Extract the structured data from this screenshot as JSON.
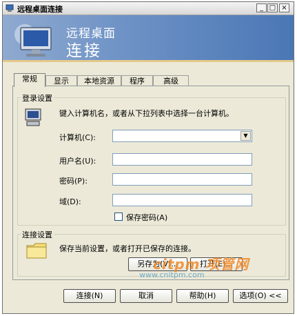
{
  "window": {
    "title": "远程桌面连接",
    "banner_line1": "远程桌面",
    "banner_line2": "连接",
    "controls": {
      "minimize": "_",
      "maximize": "□",
      "close": "×"
    }
  },
  "tabs": [
    {
      "label": "常规"
    },
    {
      "label": "显示"
    },
    {
      "label": "本地资源"
    },
    {
      "label": "程序"
    },
    {
      "label": "高级"
    }
  ],
  "login": {
    "group_label": "登录设置",
    "description": "键入计算机名，或者从下拉列表中选择一台计算机。",
    "computer_label": "计算机(C):",
    "computer_value": "",
    "username_label": "用户名(U):",
    "username_value": "",
    "password_label": "密码(P):",
    "password_value": "",
    "domain_label": "域(D):",
    "domain_value": "",
    "save_password_label": "保存密码(A)",
    "save_password_checked": false
  },
  "connection": {
    "group_label": "连接设置",
    "description": "保存当前设置，或者打开已保存的连接。",
    "save_as_label": "另存为(V)...",
    "open_label": "打开(E)..."
  },
  "footer": {
    "connect_label": "连接(N)",
    "cancel_label": "取消",
    "help_label": "帮助(H)",
    "options_label": "选项(O) <<"
  },
  "watermark": {
    "line1": "citpm 项管网",
    "line2": "www.cnitpm.com"
  },
  "icons": [
    "app-icon",
    "monitor-icon",
    "computer-icon",
    "folder-icon",
    "chevron-down-icon"
  ]
}
